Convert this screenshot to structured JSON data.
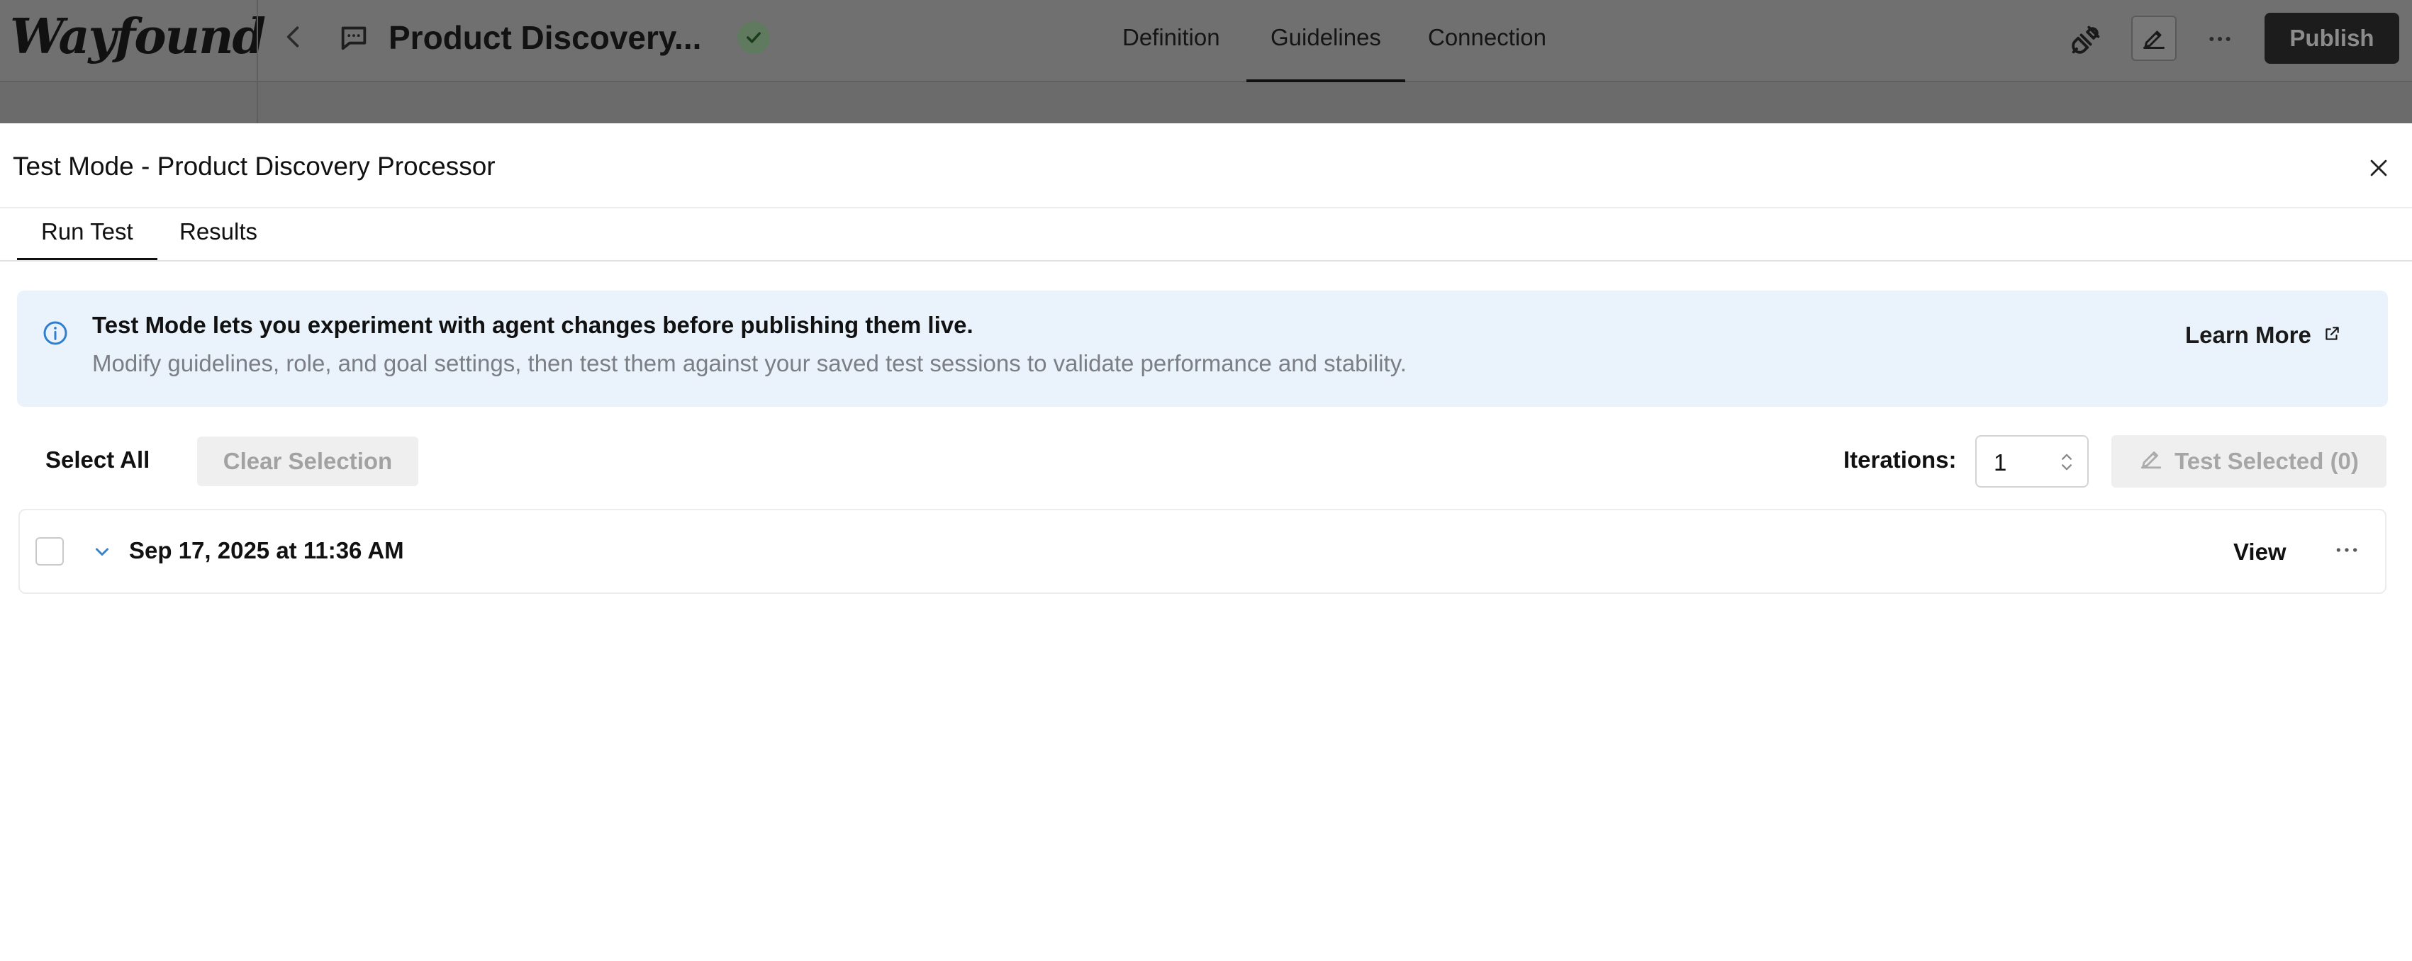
{
  "app": {
    "logo": "Wayfound",
    "title": "Product Discovery...",
    "nav_tabs": [
      {
        "label": "Definition",
        "active": false
      },
      {
        "label": "Guidelines",
        "active": true
      },
      {
        "label": "Connection",
        "active": false
      }
    ],
    "publish_label": "Publish",
    "icons": [
      "back-chevron-icon",
      "chat-bubble-icon",
      "check-icon",
      "plug-icon",
      "pen-edit-icon",
      "more-icon"
    ]
  },
  "modal": {
    "title": "Test Mode - Product Discovery Processor",
    "tabs": [
      {
        "label": "Run Test",
        "active": true
      },
      {
        "label": "Results",
        "active": false
      }
    ],
    "info": {
      "title": "Test Mode lets you experiment with agent changes before publishing them live.",
      "text": "Modify guidelines, role, and goal settings, then test them against your saved test sessions to validate performance and stability.",
      "learn_more": "Learn More"
    },
    "toolbar": {
      "select_all": "Select All",
      "clear_selection": "Clear Selection",
      "iterations_label": "Iterations:",
      "iterations_value": "1",
      "test_selected": "Test Selected (0)"
    },
    "sessions": [
      {
        "date": "Sep 17, 2025 at 11:36 AM",
        "checked": false,
        "view_label": "View"
      }
    ]
  },
  "colors": {
    "overlay": "#707070",
    "info_bg": "#eaf3fc",
    "info_icon": "#2f7fd0",
    "publish_bg": "#1c1c1c",
    "disabled_bg": "#efefef"
  }
}
